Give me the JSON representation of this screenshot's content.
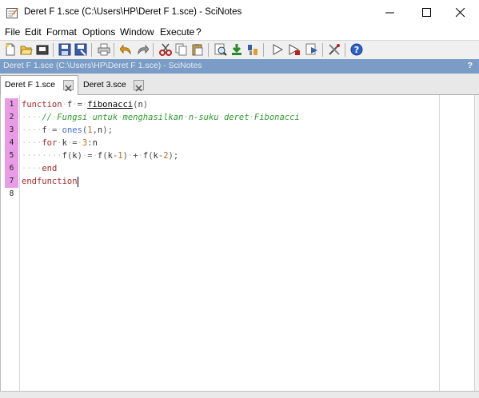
{
  "window": {
    "title": "Deret F 1.sce (C:\\Users\\HP\\Deret F 1.sce) - SciNotes"
  },
  "menu": [
    "File",
    "Edit",
    "Format",
    "Options",
    "Window",
    "Execute",
    "?"
  ],
  "path_bar": {
    "path": "Deret F 1.sce (C:\\Users\\HP\\Deret F 1.sce) - SciNotes",
    "help": "?"
  },
  "tabs": [
    {
      "label": "Deret F 1.sce",
      "active": true
    },
    {
      "label": "Deret 3.sce",
      "active": false
    }
  ],
  "editor": {
    "line_numbers": [
      "1",
      "2",
      "3",
      "4",
      "5",
      "6",
      "7",
      "8"
    ],
    "highlighted_lines": 7,
    "code_lines": [
      "function f = fibonacci(n)",
      "    // Fungsi untuk menghasilkan n-suku deret Fibonacci",
      "    f = ones(1,n);",
      "    for k = 3:n",
      "        f(k) = f(k-1) + f(k-2);",
      "    end",
      "endfunction",
      ""
    ]
  },
  "icons": {
    "app": "scinotes-icon",
    "toolbar": [
      "new-file-icon",
      "open-file-icon",
      "open-folder-icon",
      "save-icon",
      "save-as-icon",
      "print-icon",
      "undo-icon",
      "redo-icon",
      "cut-icon",
      "copy-icon",
      "paste-icon",
      "find-icon",
      "save-and-execute-icon",
      "load-icon",
      "execute-icon",
      "execute-until-icon",
      "show-variables-icon",
      "settings-icon",
      "help-icon"
    ]
  }
}
